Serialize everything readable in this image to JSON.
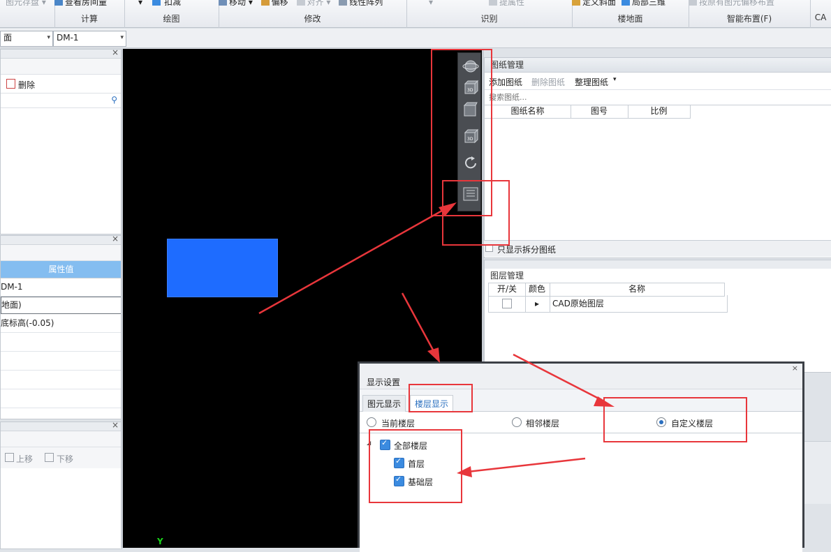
{
  "ribbon": {
    "groups": [
      {
        "title": "",
        "items": [
          "图元存盘 ▾"
        ]
      },
      {
        "title": "计算",
        "items": [
          "查看房间量"
        ]
      },
      {
        "title": "绘图",
        "items": [
          "▾",
          "扣减"
        ]
      },
      {
        "title": "修改",
        "items": [
          "移动 ▾",
          "偏移",
          "对齐 ▾",
          "线性阵列"
        ]
      },
      {
        "title": "识别",
        "items": [
          "▾",
          "提属性"
        ]
      },
      {
        "title": "楼地面",
        "items": [
          "定义斜面",
          "局部三维"
        ]
      },
      {
        "title": "智能布置(F)",
        "items": [
          "按原有图元偏移布置"
        ]
      },
      {
        "title": "CA",
        "items": [
          ""
        ]
      }
    ]
  },
  "selectors": {
    "floor_suffix": "面",
    "component": "DM-1"
  },
  "left_panel_top": {
    "delete_label": "删除"
  },
  "properties_panel": {
    "header": "属性值",
    "rows": [
      "DM-1",
      "地面)",
      "底标高(-0.05)",
      "",
      "",
      "",
      ""
    ]
  },
  "left_panel_bottom": {
    "move_up": "上移",
    "move_down": "下移"
  },
  "drawing_panel": {
    "title": "图纸管理",
    "add": "添加图纸",
    "delete": "删除图纸",
    "organize": "整理图纸",
    "search_placeholder": "搜索图纸...",
    "columns": [
      "图纸名称",
      "图号",
      "比例"
    ],
    "only_split_label": "只显示拆分图纸"
  },
  "layer_panel": {
    "title": "图层管理",
    "columns": [
      "开/关",
      "颜色",
      "名称"
    ],
    "rows": [
      {
        "name": "CAD原始图层"
      }
    ]
  },
  "canvas": {
    "axis_label": "Y",
    "rect_color": "#1e6cff"
  },
  "dialog": {
    "title": "显示设置",
    "tabs": [
      "图元显示",
      "楼层显示"
    ],
    "radios": [
      "当前楼层",
      "相邻楼层",
      "自定义楼层"
    ],
    "tree": {
      "root": "全部楼层",
      "children": [
        "首层",
        "基础层"
      ]
    }
  },
  "colors": {
    "annotation": "#e8363b",
    "accent": "#3b8be0"
  }
}
